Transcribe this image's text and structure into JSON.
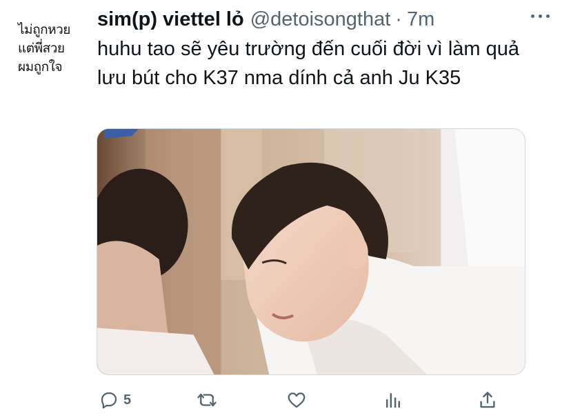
{
  "avatar": {
    "lines": [
      "ไม่ถูกหวย",
      "แต่พี่สวย",
      "ผมถูกใจ"
    ]
  },
  "tweet": {
    "display_name": "sim(p) viettel lỏ",
    "handle": "@detoisongthat",
    "separator": "·",
    "time": "7m",
    "text": "huhu tao sẽ yêu trường đến cuối đời vì làm quả lưu bút cho K37 nma dính cả anh Ju K35"
  },
  "media": {
    "kind": "photo"
  },
  "actions": {
    "reply": {
      "icon": "reply-icon",
      "count": "5"
    },
    "retweet": {
      "icon": "retweet-icon"
    },
    "like": {
      "icon": "heart-icon"
    },
    "analytics": {
      "icon": "analytics-icon"
    },
    "share": {
      "icon": "share-icon"
    }
  },
  "colors": {
    "text": "#0f1419",
    "secondary": "#536471",
    "border": "#cfd9de"
  }
}
